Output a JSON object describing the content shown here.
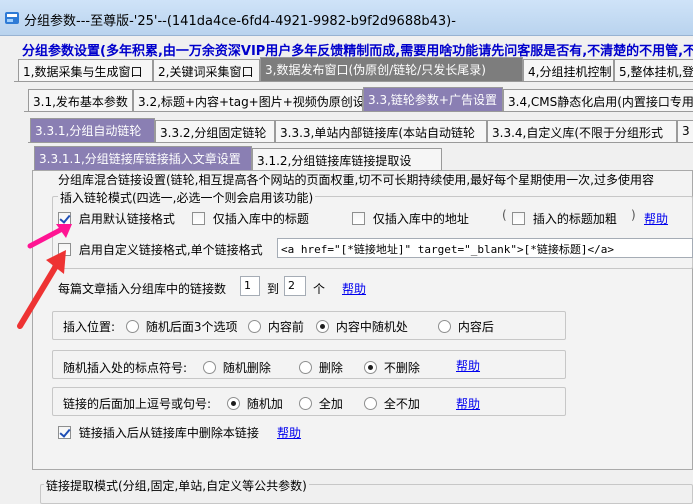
{
  "window": {
    "title": "分组参数---至尊版-'25'--(141da4ce-6fd4-4921-9982-b9f2d9688b43)-"
  },
  "notice": "分组参数设置(多年积累,由一万余资深VIP用户多年反馈精制而成,需要用啥功能请先问客服是否有,不清楚的不用管,不",
  "tabs_level1": [
    "1,数据采集与生成窗口",
    "2,关键词采集窗口",
    "3,数据发布窗口(伪原创/链轮/只发长尾录)",
    "4,分组挂机控制",
    "5,整体挂机,登陆"
  ],
  "tabs_level2": [
    "3.1,发布基本参数",
    "3.2,标题+内容+tag+图片+视频伪原创设",
    "3.3,链轮参数+广告设置",
    "3.4,CMS静态化启用(内置接口专用"
  ],
  "tabs_level3": [
    "3.3.1,分组自动链轮",
    "3.3.2,分组固定链轮",
    "3.3.3,单站内部链接库(本站自动链轮",
    "3.3.4,自定义库(不限于分组形式",
    "3"
  ],
  "tabs_level4": [
    "3.3.1.1,分组链接库链接插入文章设置",
    "3.1.2,分组链接库链接提取设"
  ],
  "settings": {
    "mix_desc": "分组库混合链接设置(链轮,相互提高各个网站的页面权重,切不可长期持续使用,最好每个星期使用一次,过多使用容",
    "insert_mode_legend": "插入链轮模式(四选一,必选一个则会启用该功能)",
    "opt_default_format": "启用默认链接格式",
    "opt_title_only": "仅插入库中的标题",
    "opt_url_only": "仅插入库中的地址",
    "opt_bold": "插入的标题加粗",
    "help": "帮助",
    "opt_custom_format": "启用自定义链接格式,单个链接格式",
    "custom_format_value": "<a href=\"[*链接地址]\" target=\"_blank\">[*链接标题]</a>",
    "links_per_article_label": "每篇文章插入分组库中的链接数",
    "links_min": "1",
    "links_to": "到",
    "links_max": "2",
    "links_unit": "个",
    "position_label": "插入位置:",
    "position_options": [
      "随机后面3个选项",
      "内容前",
      "内容中随机处",
      "内容后"
    ],
    "punct_label": "随机插入处的标点符号:",
    "punct_options": [
      "随机删除",
      "删除",
      "不删除"
    ],
    "comma_label": "链接的后面加上逗号或句号:",
    "comma_options": [
      "随机加",
      "全加",
      "全不加"
    ],
    "delete_after_insert": "链接插入后从链接库中删除本链接",
    "extract_mode_legend": "链接提取模式(分组,固定,单站,自定义等公共参数)"
  },
  "colors": {
    "arrow": "#ff1493",
    "arrow2": "#ee3333",
    "link": "#0000ee",
    "notice": "#0000cc",
    "active_tab": "#7d7d7d"
  }
}
